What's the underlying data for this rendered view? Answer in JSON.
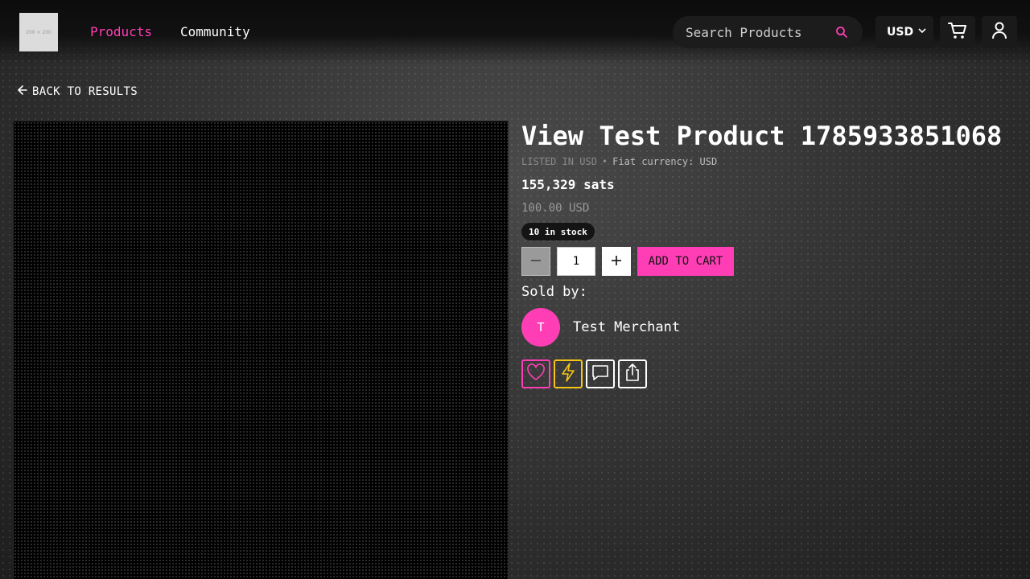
{
  "header": {
    "logo_text": "200 × 200",
    "nav": [
      {
        "label": "Products",
        "active": true
      },
      {
        "label": "Community",
        "active": false
      }
    ],
    "search": {
      "placeholder": "Search Products",
      "icon": "search-icon"
    },
    "currency": {
      "selected": "USD",
      "icon": "chevron-down-icon"
    },
    "cart_icon": "cart-icon",
    "account_icon": "user-icon"
  },
  "back_link": {
    "label": "BACK TO RESULTS",
    "icon": "arrow-left-icon"
  },
  "product": {
    "title": "View Test Product 1785933851068",
    "listed_in": "LISTED IN USD",
    "separator": "•",
    "fiat_currency": "Fiat currency: USD",
    "price_sats": "155,329 sats",
    "price_fiat": "100.00 USD",
    "stock_badge": "10 in stock",
    "quantity": "1",
    "add_to_cart_label": "ADD TO CART"
  },
  "seller": {
    "heading": "Sold by:",
    "avatar_initial": "T",
    "name": "Test Merchant"
  },
  "actions": [
    {
      "name": "favorite",
      "icon": "heart-icon",
      "color": "#ff3eb5"
    },
    {
      "name": "zap",
      "icon": "lightning-icon",
      "color": "#f5c518"
    },
    {
      "name": "message",
      "icon": "chat-icon",
      "color": "#ffffff"
    },
    {
      "name": "share",
      "icon": "share-icon",
      "color": "#ffffff"
    }
  ],
  "colors": {
    "accent": "#ff3eb5",
    "zap": "#f5c518"
  }
}
